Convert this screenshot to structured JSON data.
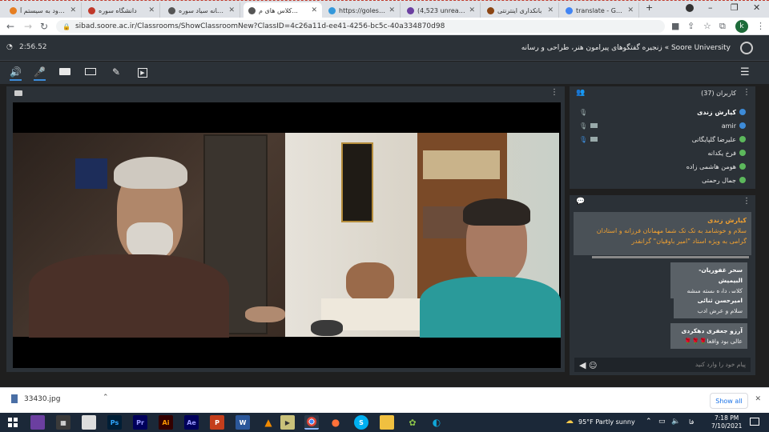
{
  "browser": {
    "tabs": [
      {
        "label": "ورود به سیستم آ...",
        "color": "#e67e22"
      },
      {
        "label": "دانشگاه سوره",
        "color": "#c0392b"
      },
      {
        "label": "سامانه سیاد سوره",
        "color": "#555555"
      },
      {
        "label": "کلاس های م...",
        "color": "#555555",
        "active": true
      },
      {
        "label": "https://golestan...",
        "color": "#3498db"
      },
      {
        "label": "(4,523 unread) -",
        "color": "#6b3fa0"
      },
      {
        "label": "بانکداری اینترنتی",
        "color": "#8b4513"
      },
      {
        "label": "translate - Google",
        "color": "#4285f4"
      }
    ],
    "new_tab": "+",
    "url": "sibad.soore.ac.ir/Classrooms/ShowClassroomNew?ClassID=4c26a11d-ee41-4256-bc5c-40a334870d98",
    "profile": "k"
  },
  "app": {
    "timer": "2:56.52",
    "breadcrumb": "Soore University » زنجیره گفتگوهای پیرامون هنر، طراحی و رسانه",
    "toolbar": {
      "menu": "☰"
    }
  },
  "users": {
    "header": "کاربران (37)",
    "list": [
      {
        "name": "کیارش زندی",
        "bold": true,
        "color": "#3d8bd8",
        "mic": true,
        "cam": false
      },
      {
        "name": "amir",
        "bold": false,
        "color": "#3d8bd8",
        "mic": true,
        "cam": true
      },
      {
        "name": "علیرضا گلپایگانی",
        "bold": false,
        "color": "#5cb85c",
        "mic": true,
        "cam": true
      },
      {
        "name": "فرخ یکدانه",
        "bold": false,
        "color": "#5cb85c",
        "mic": false,
        "cam": false
      },
      {
        "name": "هومن هاشمی زاده",
        "bold": false,
        "color": "#5cb85c",
        "mic": false,
        "cam": false
      },
      {
        "name": "جمال رحمتی",
        "bold": false,
        "color": "#5cb85c",
        "mic": false,
        "cam": false
      }
    ]
  },
  "chat": {
    "main": {
      "author": "کیارش زندی",
      "text": "سلام و خوشامد به تک تک شما مهمانان فرزانه و استادان گرامی به ویژه استاد \"امیر باوقیان\" گرانقدر"
    },
    "messages": [
      {
        "author": "سحر غفوریان-البیمیش",
        "text": "کلاس داره بسته میشه"
      },
      {
        "author": "امیرحسن ثنائی",
        "text": "سلام و  عرض ادب"
      },
      {
        "author": "آرزو جعفری دهکردی",
        "text": "عالی بود واقعا🌹🌹🌹"
      }
    ],
    "input_placeholder": "پیام خود را وارد کنید"
  },
  "downloads": {
    "file": "33430.jpg",
    "show_all": "Show all"
  },
  "taskbar": {
    "weather": "95°F  Partly sunny",
    "lang": "فا",
    "time": "7:18 PM",
    "date": "7/10/2021"
  }
}
